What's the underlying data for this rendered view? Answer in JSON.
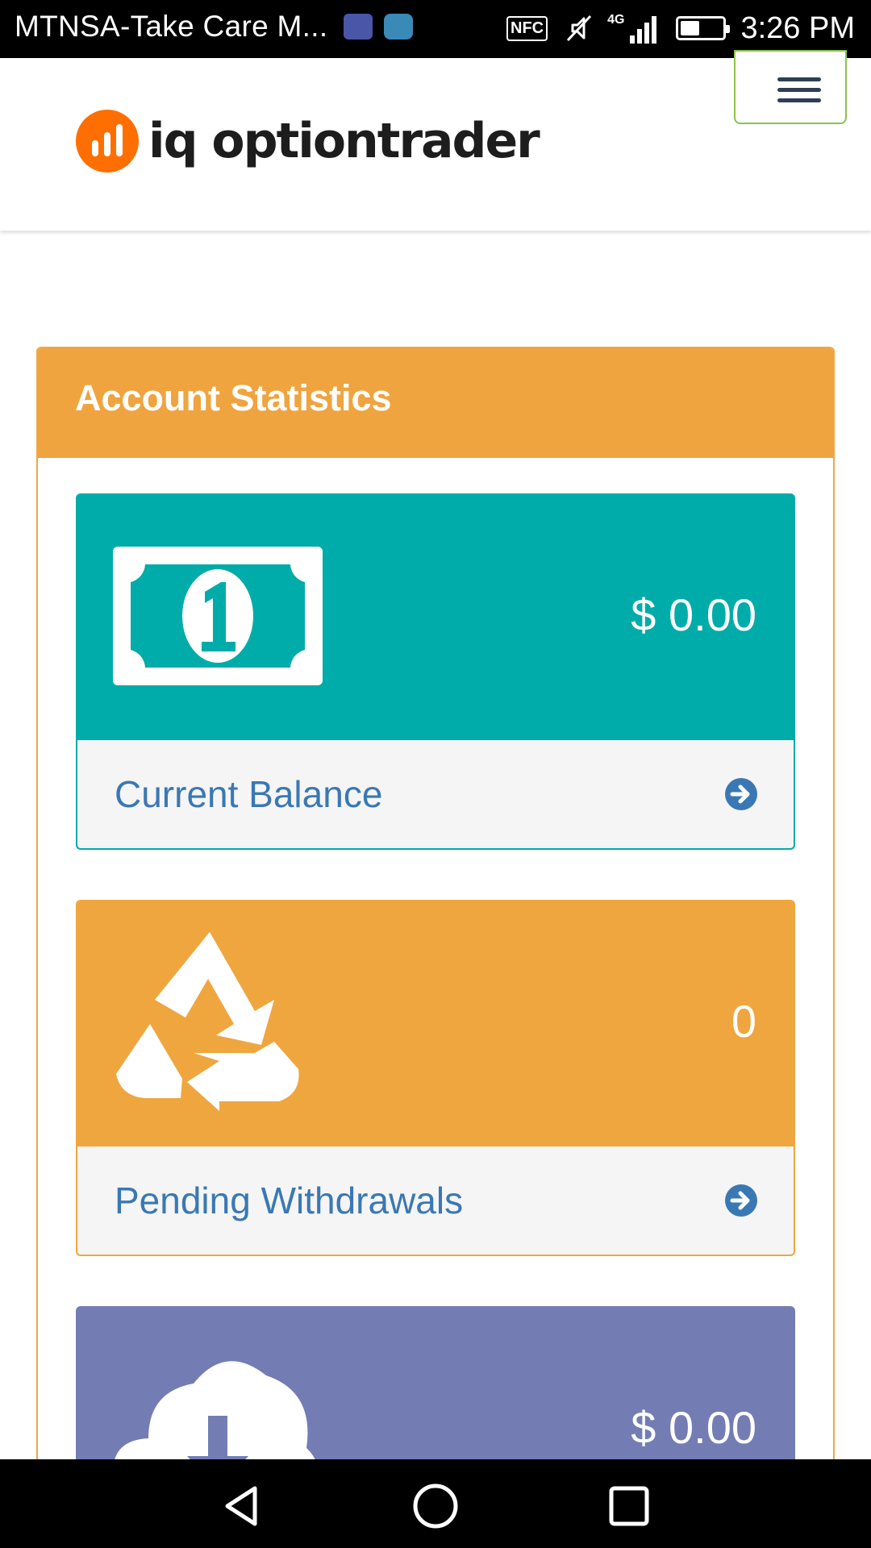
{
  "status_bar": {
    "notification_title": "MTNSA-Take Care M...",
    "nfc_label": "NFC",
    "network_label": "4G",
    "battery_level": 0.4,
    "time": "3:26 PM"
  },
  "header": {
    "logo_text": "iq optiontrader",
    "menu_icon": "hamburger-icon"
  },
  "panel": {
    "title": "Account Statistics",
    "cards": [
      {
        "value": "$ 0.00",
        "label": "Current Balance",
        "icon": "dollar-bill-icon",
        "color": "#00aca9"
      },
      {
        "value": "0",
        "label": "Pending Withdrawals",
        "icon": "recycle-icon",
        "color": "#efa63f"
      },
      {
        "value": "$ 0.00",
        "label": "",
        "icon": "cloud-download-icon",
        "color": "#737db3"
      }
    ]
  },
  "colors": {
    "accent_orange": "#efa43f",
    "teal": "#00aca9",
    "purple": "#737db3",
    "link_blue": "#3a78b4",
    "logo_orange": "#ff6e00"
  },
  "nav_bar": {
    "back": "back-triangle-icon",
    "home": "home-circle-icon",
    "recents": "recents-square-icon"
  }
}
